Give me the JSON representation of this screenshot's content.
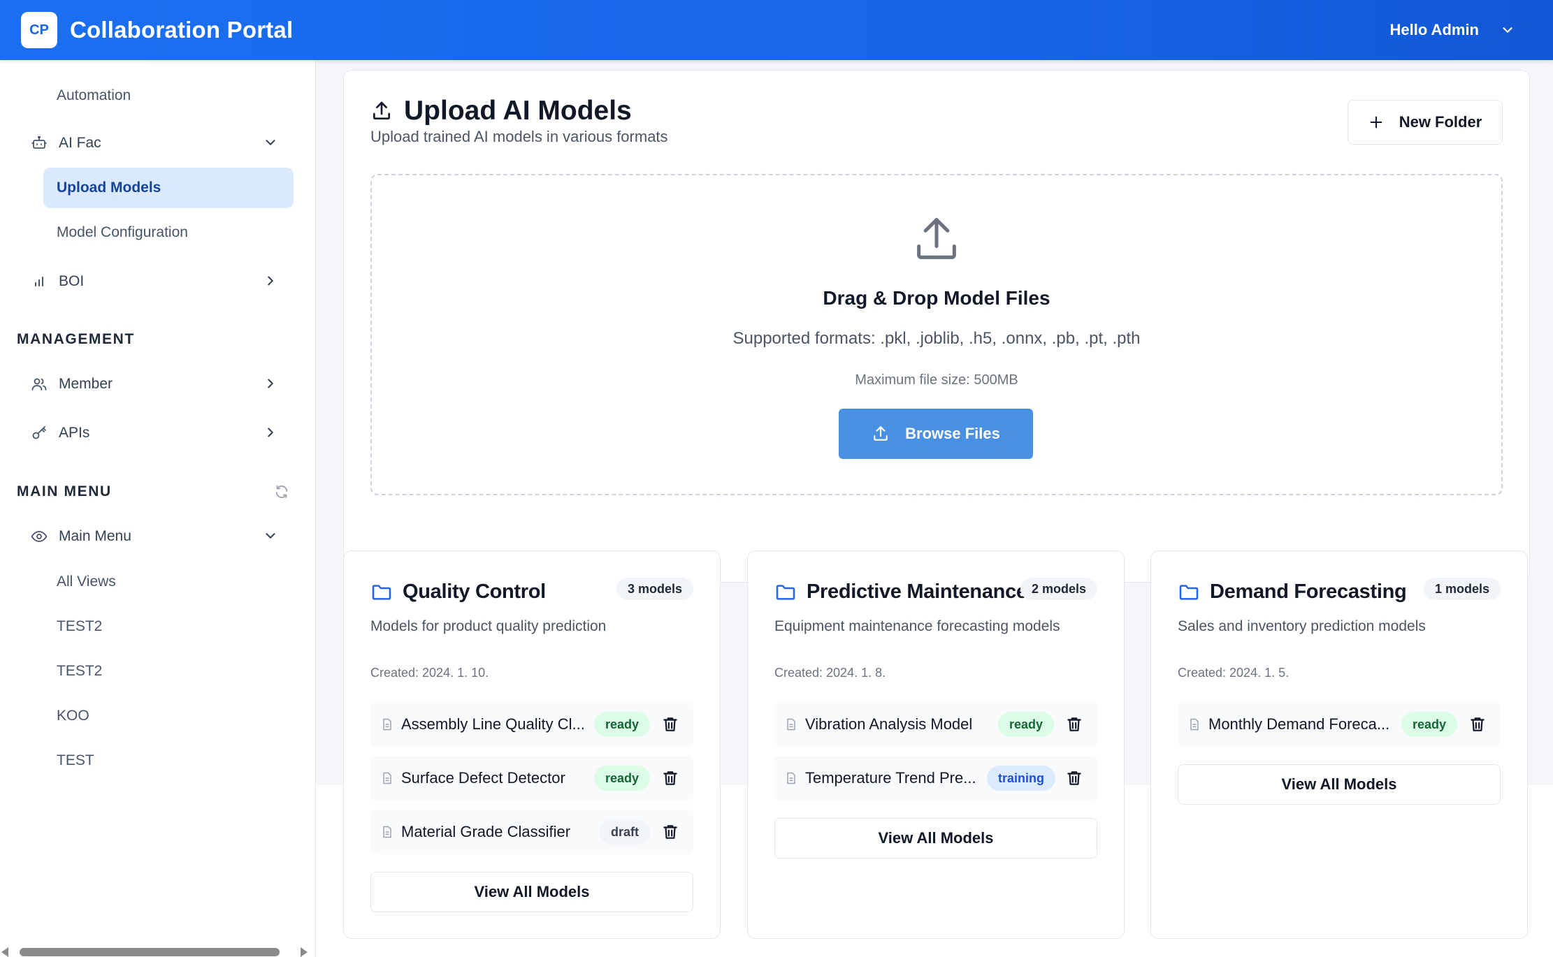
{
  "header": {
    "logo_text": "CP",
    "app_title": "Collaboration Portal",
    "user_greeting": "Hello Admin"
  },
  "sidebar": {
    "automation": "Automation",
    "ai_fac": "AI Fac",
    "upload_models": "Upload Models",
    "model_configuration": "Model Configuration",
    "boi": "BOI",
    "management_title": "MANAGEMENT",
    "member": "Member",
    "apis": "APIs",
    "main_menu_title": "MAIN MENU",
    "main_menu": "Main Menu",
    "views": [
      "All Views",
      "TEST2",
      "TEST2",
      "KOO",
      "TEST"
    ]
  },
  "upload": {
    "title": "Upload AI Models",
    "subtitle": "Upload trained AI models in various formats",
    "new_folder_label": "New Folder",
    "drop_title": "Drag & Drop Model Files",
    "supported_formats": "Supported formats: .pkl, .joblib, .h5, .onnx, .pb, .pt, .pth",
    "max_size": "Maximum file size: 500MB",
    "browse_label": "Browse Files"
  },
  "folders": [
    {
      "name": "Quality Control",
      "badge": "3 models",
      "description": "Models for product quality prediction",
      "created": "Created: 2024. 1. 10.",
      "models": [
        {
          "name": "Assembly Line Quality Cl...",
          "status": "ready"
        },
        {
          "name": "Surface Defect Detector",
          "status": "ready"
        },
        {
          "name": "Material Grade Classifier",
          "status": "draft"
        }
      ],
      "view_all": "View All Models"
    },
    {
      "name": "Predictive Maintenance",
      "badge": "2 models",
      "description": "Equipment maintenance forecasting models",
      "created": "Created: 2024. 1. 8.",
      "models": [
        {
          "name": "Vibration Analysis Model",
          "status": "ready"
        },
        {
          "name": "Temperature Trend Pre...",
          "status": "training"
        }
      ],
      "view_all": "View All Models"
    },
    {
      "name": "Demand Forecasting",
      "badge": "1 models",
      "description": "Sales and inventory prediction models",
      "created": "Created: 2024. 1. 5.",
      "models": [
        {
          "name": "Monthly Demand Foreca...",
          "status": "ready"
        }
      ],
      "view_all": "View All Models"
    }
  ],
  "colors": {
    "header_blue": "#1766e8",
    "active_bg": "#dbe9fd",
    "active_text": "#17449b",
    "browse_button": "#4a90e2",
    "folder_icon": "#2563eb",
    "ready_bg": "#dcfce7",
    "training_bg": "#dbeafe"
  },
  "icons": {
    "upload_title": "upload-icon",
    "dropzone": "upload-icon",
    "folder": "folder-icon",
    "model_file": "file-icon",
    "delete": "trash-icon"
  }
}
